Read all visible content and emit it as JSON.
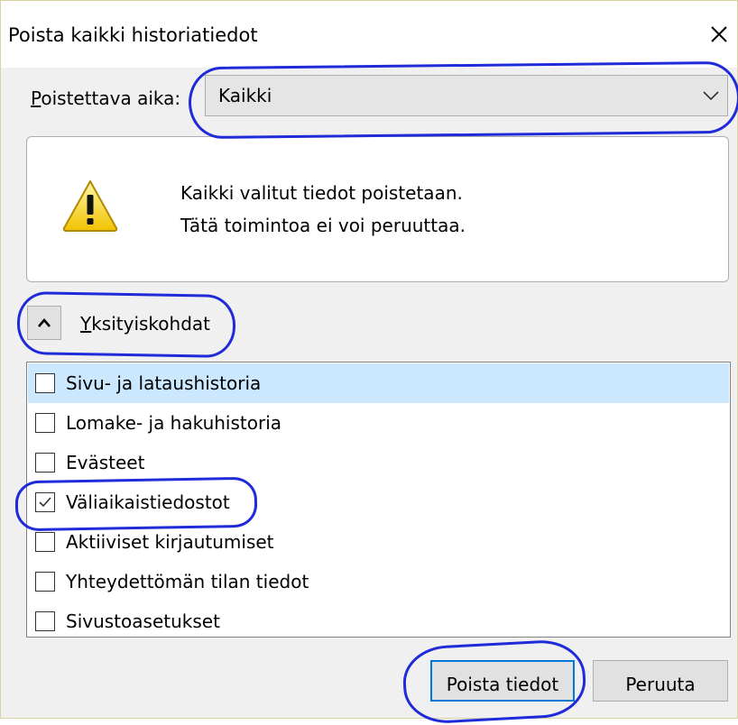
{
  "window": {
    "title": "Poista kaikki historiatiedot",
    "close_icon": "close-icon"
  },
  "time_range": {
    "label_accesskey": "P",
    "label_rest": "oistettava aika:",
    "selected_value": "Kaikki"
  },
  "warning": {
    "icon": "warning-icon",
    "line1": "Kaikki valitut tiedot poistetaan.",
    "line2": "Tätä toimintoa ei voi peruuttaa."
  },
  "details": {
    "toggle_icon": "chevron-up-icon",
    "label_accesskey": "Y",
    "label_rest": "ksityiskohdat",
    "expanded": true
  },
  "items": [
    {
      "label": "Sivu- ja lataushistoria",
      "checked": false,
      "selected": true
    },
    {
      "label": "Lomake- ja hakuhistoria",
      "checked": false,
      "selected": false
    },
    {
      "label": "Evästeet",
      "checked": false,
      "selected": false
    },
    {
      "label": "Väliaikaistiedostot",
      "checked": true,
      "selected": false
    },
    {
      "label": "Aktiiviset kirjautumiset",
      "checked": false,
      "selected": false
    },
    {
      "label": "Yhteydettömän tilan tiedot",
      "checked": false,
      "selected": false
    },
    {
      "label": "Sivustoasetukset",
      "checked": false,
      "selected": false
    }
  ],
  "buttons": {
    "clear": "Poista tiedot",
    "cancel": "Peruuta"
  },
  "colors": {
    "annotation": "#1f2bd8",
    "selection": "#cce8ff",
    "focus": "#0078d7"
  }
}
